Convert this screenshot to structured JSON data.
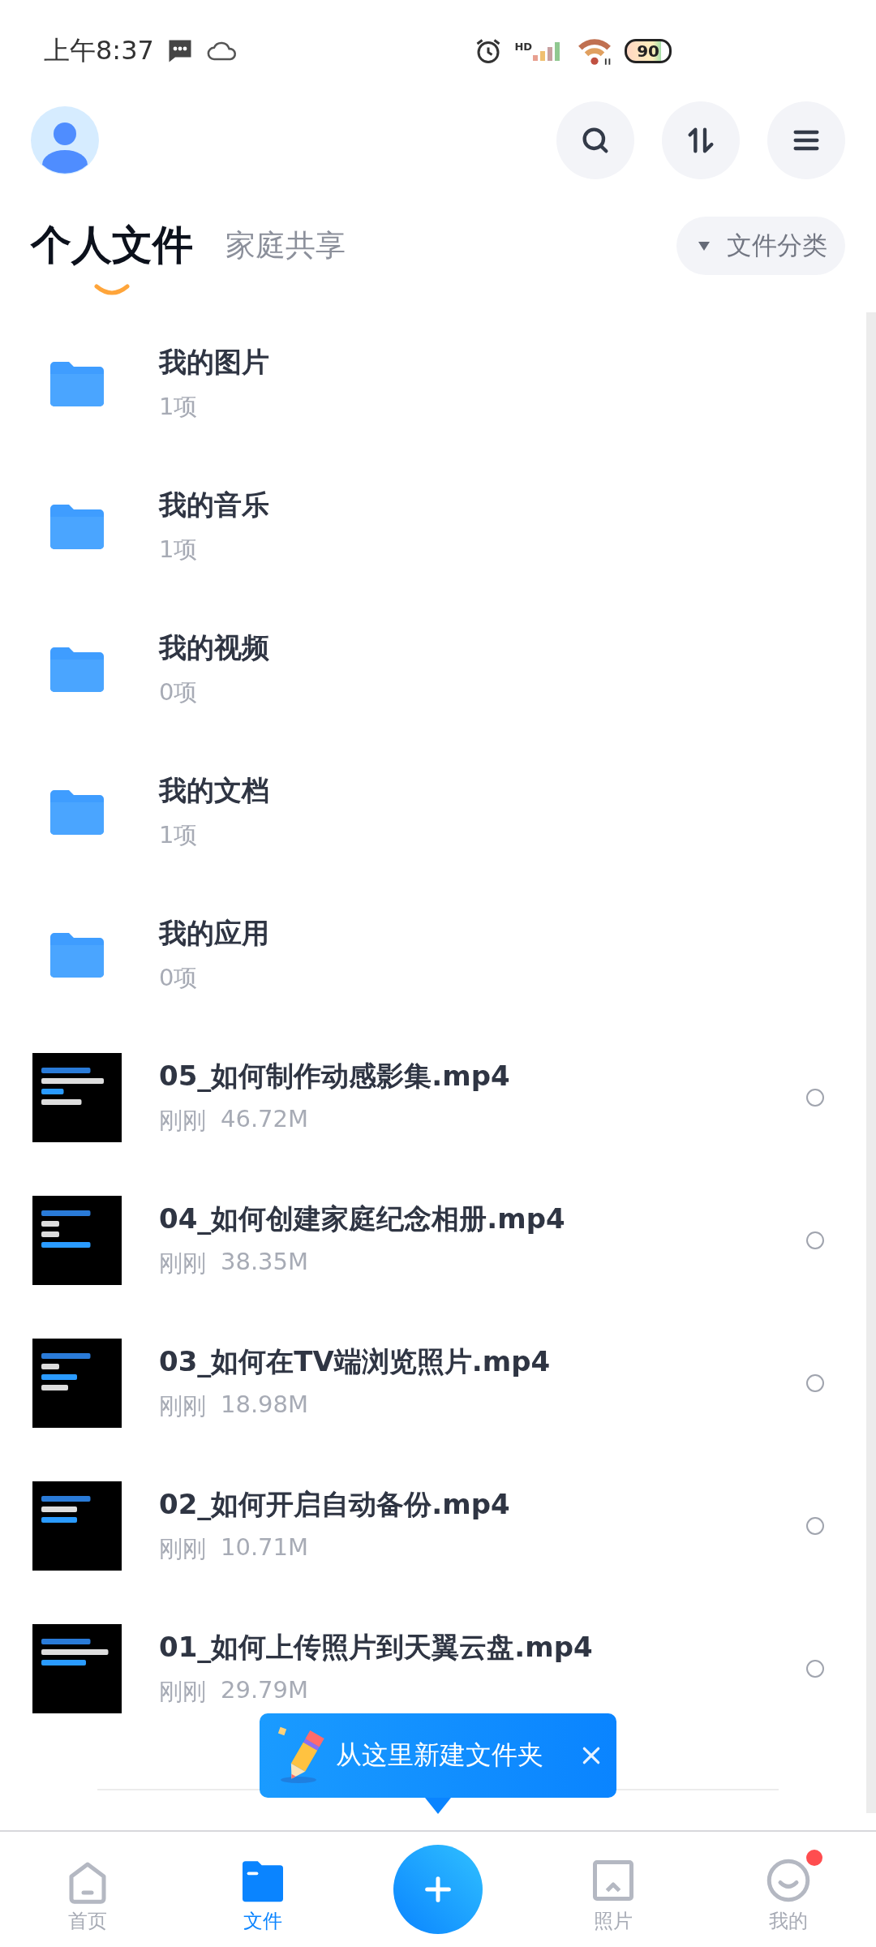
{
  "status_bar": {
    "time": "上午8:37",
    "network": "HD",
    "battery": "90"
  },
  "tabs": [
    {
      "label": "个人文件",
      "selected": true
    },
    {
      "label": "家庭共享",
      "selected": false
    }
  ],
  "filter_button": {
    "label": "文件分类"
  },
  "folders": [
    {
      "name": "我的图片",
      "count": "1项"
    },
    {
      "name": "我的音乐",
      "count": "1项"
    },
    {
      "name": "我的视频",
      "count": "0项"
    },
    {
      "name": "我的文档",
      "count": "1项"
    },
    {
      "name": "我的应用",
      "count": "0项"
    }
  ],
  "files": [
    {
      "name": "05_如何制作动感影集.mp4",
      "time": "刚刚",
      "size": "46.72M",
      "checked": false
    },
    {
      "name": "04_如何创建家庭纪念相册.mp4",
      "time": "刚刚",
      "size": "38.35M",
      "checked": false
    },
    {
      "name": "03_如何在TV端浏览照片.mp4",
      "time": "刚刚",
      "size": "18.98M",
      "checked": false
    },
    {
      "name": "02_如何开启自动备份.mp4",
      "time": "刚刚",
      "size": "10.71M",
      "checked": false
    },
    {
      "name": "01_如何上传照片到天翼云盘.mp4",
      "time": "刚刚",
      "size": "29.79M",
      "checked": false
    }
  ],
  "tooltip": {
    "text": "从这里新建文件夹"
  },
  "nav": [
    {
      "kind": "home",
      "label": "首页",
      "selected": false,
      "badge": false
    },
    {
      "kind": "files",
      "label": "文件",
      "selected": true,
      "badge": false
    },
    {
      "kind": "add"
    },
    {
      "kind": "photos",
      "label": "照片",
      "selected": false,
      "badge": false
    },
    {
      "kind": "me",
      "label": "我的",
      "selected": false,
      "badge": true
    }
  ]
}
